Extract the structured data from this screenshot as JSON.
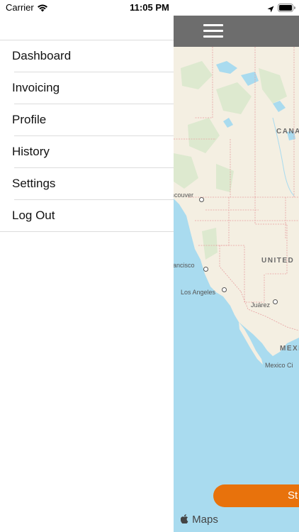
{
  "status_bar": {
    "carrier": "Carrier",
    "time": "11:05 PM",
    "icons": [
      "wifi-icon",
      "location-arrow-icon",
      "battery-icon"
    ]
  },
  "menu": {
    "items": [
      {
        "label": "Dashboard"
      },
      {
        "label": "Invoicing"
      },
      {
        "label": "Profile"
      },
      {
        "label": "History"
      },
      {
        "label": "Settings"
      },
      {
        "label": "Log Out"
      }
    ]
  },
  "nav": {
    "menu_icon": "hamburger-menu-icon",
    "bar_color": "#6d6d6d"
  },
  "map": {
    "country_labels": [
      "CANA",
      "UNITED",
      "MEXI"
    ],
    "city_labels": [
      "ncouver",
      "rancisco",
      "Los Angeles",
      "Juárez",
      "Mexico Ci"
    ],
    "attribution": "Maps",
    "water_color": "#a9dbef",
    "land_color": "#f4efe2"
  },
  "action": {
    "button_label": "St",
    "button_color": "#e8720c"
  }
}
